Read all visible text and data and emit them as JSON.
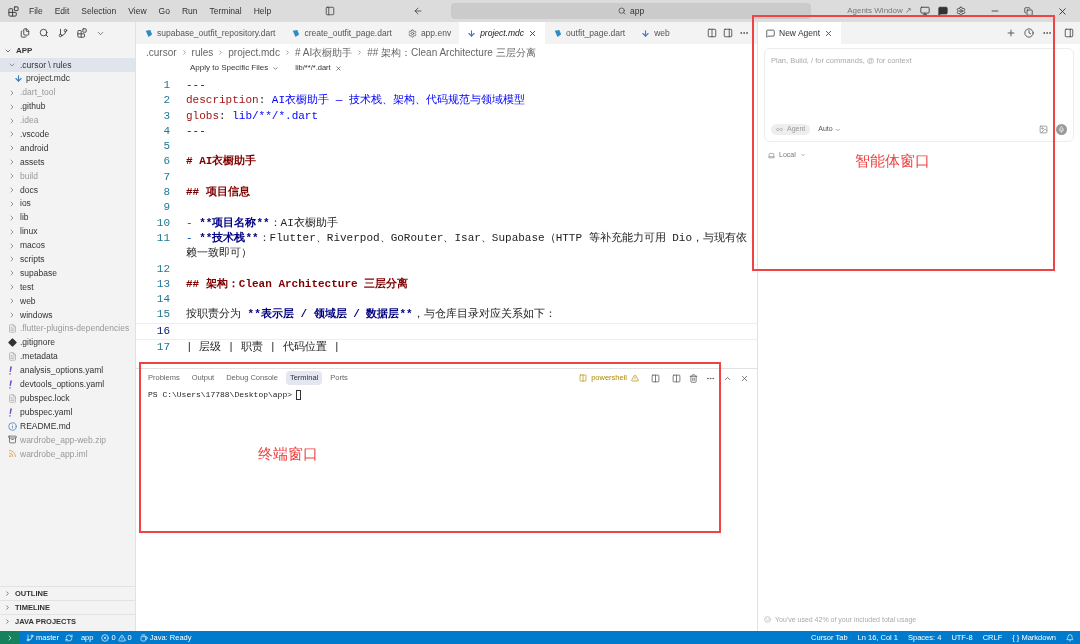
{
  "menu": [
    "File",
    "Edit",
    "Selection",
    "View",
    "Go",
    "Run",
    "Terminal",
    "Help"
  ],
  "search": {
    "value": "app"
  },
  "agents_window": "Agents Window ↗",
  "tabs": [
    {
      "label": "supabase_outfit_repository.dart",
      "kind": "dart",
      "selected": false
    },
    {
      "label": "create_outfit_page.dart",
      "kind": "dart",
      "selected": false
    },
    {
      "label": "app.env",
      "kind": "env",
      "selected": false
    },
    {
      "label": "project.mdc",
      "kind": "mdc",
      "selected": true
    },
    {
      "label": "outfit_page.dart",
      "kind": "dart",
      "selected": false
    },
    {
      "label": "web",
      "kind": "mdc",
      "selected": false
    }
  ],
  "breadcrumbs": [
    ".cursor",
    "rules",
    "project.mdc",
    "# AI衣橱助手",
    "## 架构：Clean Architecture 三层分离"
  ],
  "rule_bar": {
    "mode": "Apply to Specific Files",
    "glob": "lib/**/*.dart"
  },
  "explorer": {
    "title": "APP",
    "items": [
      {
        "label": ".cursor \\ rules",
        "kind": "folder",
        "dimmed": false,
        "selected": true,
        "expanded": true,
        "children": [
          {
            "label": "project.mdc",
            "kind": "mdc",
            "dimmed": false,
            "selected": false
          }
        ]
      },
      {
        "label": ".dart_tool",
        "kind": "folder",
        "dimmed": true,
        "selected": false,
        "expanded": false
      },
      {
        "label": ".github",
        "kind": "folder",
        "dimmed": false,
        "selected": false,
        "expanded": false
      },
      {
        "label": ".idea",
        "kind": "folder",
        "dimmed": true,
        "selected": false,
        "expanded": false
      },
      {
        "label": ".vscode",
        "kind": "folder",
        "dimmed": false,
        "selected": false,
        "expanded": false
      },
      {
        "label": "android",
        "kind": "folder",
        "dimmed": false,
        "selected": false,
        "expanded": false
      },
      {
        "label": "assets",
        "kind": "folder",
        "dimmed": false,
        "selected": false,
        "expanded": false
      },
      {
        "label": "build",
        "kind": "folder",
        "dimmed": true,
        "selected": false,
        "expanded": false
      },
      {
        "label": "docs",
        "kind": "folder",
        "dimmed": false,
        "selected": false,
        "expanded": false
      },
      {
        "label": "ios",
        "kind": "folder",
        "dimmed": false,
        "selected": false,
        "expanded": false
      },
      {
        "label": "lib",
        "kind": "folder",
        "dimmed": false,
        "selected": false,
        "expanded": false
      },
      {
        "label": "linux",
        "kind": "folder",
        "dimmed": false,
        "selected": false,
        "expanded": false
      },
      {
        "label": "macos",
        "kind": "folder",
        "dimmed": false,
        "selected": false,
        "expanded": false
      },
      {
        "label": "scripts",
        "kind": "folder",
        "dimmed": false,
        "selected": false,
        "expanded": false
      },
      {
        "label": "supabase",
        "kind": "folder",
        "dimmed": false,
        "selected": false,
        "expanded": false
      },
      {
        "label": "test",
        "kind": "folder",
        "dimmed": false,
        "selected": false,
        "expanded": false
      },
      {
        "label": "web",
        "kind": "folder",
        "dimmed": false,
        "selected": false,
        "expanded": false
      },
      {
        "label": "windows",
        "kind": "folder",
        "dimmed": false,
        "selected": false,
        "expanded": false
      },
      {
        "label": ".flutter-plugins-dependencies",
        "kind": "text",
        "dimmed": true,
        "selected": false
      },
      {
        "label": ".gitignore",
        "kind": "git",
        "dimmed": false,
        "selected": false
      },
      {
        "label": ".metadata",
        "kind": "text",
        "dimmed": false,
        "selected": false
      },
      {
        "label": "analysis_options.yaml",
        "kind": "yaml",
        "dimmed": false,
        "selected": false
      },
      {
        "label": "devtools_options.yaml",
        "kind": "yaml",
        "dimmed": false,
        "selected": false
      },
      {
        "label": "pubspec.lock",
        "kind": "text",
        "dimmed": false,
        "selected": false
      },
      {
        "label": "pubspec.yaml",
        "kind": "yaml",
        "dimmed": false,
        "selected": false
      },
      {
        "label": "README.md",
        "kind": "info",
        "dimmed": false,
        "selected": false
      },
      {
        "label": "wardrobe_app-web.zip",
        "kind": "zip",
        "dimmed": true,
        "selected": false
      },
      {
        "label": "wardrobe_app.iml",
        "kind": "rss",
        "dimmed": true,
        "selected": false
      }
    ]
  },
  "sections": [
    "OUTLINE",
    "TIMELINE",
    "JAVA PROJECTS"
  ],
  "editor": {
    "lines": [
      {
        "number": "1",
        "current": false,
        "segments": [
          {
            "kind": "plain",
            "text": "---"
          }
        ]
      },
      {
        "number": "2",
        "current": false,
        "segments": [
          {
            "kind": "key",
            "text": "description"
          },
          {
            "kind": "plain",
            "text": ": "
          },
          {
            "kind": "value",
            "text": "AI衣橱助手 — 技术栈、架构、代码规范与领域模型"
          }
        ]
      },
      {
        "number": "3",
        "current": false,
        "segments": [
          {
            "kind": "key",
            "text": "globs"
          },
          {
            "kind": "plain",
            "text": ": "
          },
          {
            "kind": "value",
            "text": "lib/**/*.dart"
          }
        ]
      },
      {
        "number": "4",
        "current": false,
        "segments": [
          {
            "kind": "plain",
            "text": "---"
          }
        ]
      },
      {
        "number": "5",
        "current": false
      },
      {
        "number": "6",
        "current": false,
        "segments": [
          {
            "kind": "heading",
            "text": "# AI衣橱助手"
          }
        ]
      },
      {
        "number": "7",
        "current": false
      },
      {
        "number": "8",
        "current": false,
        "segments": [
          {
            "kind": "heading",
            "text": "## 项目信息"
          }
        ]
      },
      {
        "number": "9",
        "current": false
      },
      {
        "number": "10",
        "current": false,
        "segments": [
          {
            "kind": "punct",
            "text": "- "
          },
          {
            "kind": "bold",
            "text": "**项目名称**"
          },
          {
            "kind": "plain",
            "text": "：AI衣橱助手"
          }
        ]
      },
      {
        "number": "11",
        "current": false,
        "segments": [
          {
            "kind": "punct",
            "text": "- "
          },
          {
            "kind": "bold",
            "text": "**技术栈**"
          },
          {
            "kind": "plain",
            "text": "：Flutter、Riverpod、GoRouter、Isar、Supabase（HTTP 等补充能力可用 Dio，与现有依赖一致即可）"
          }
        ]
      },
      {
        "number": "12",
        "current": false
      },
      {
        "number": "13",
        "current": false,
        "segments": [
          {
            "kind": "heading",
            "text": "## 架构：Clean Architecture 三层分离"
          }
        ]
      },
      {
        "number": "14",
        "current": false
      },
      {
        "number": "15",
        "current": false,
        "segments": [
          {
            "kind": "plain",
            "text": "按职责分为 "
          },
          {
            "kind": "bold",
            "text": "**表示层 / 领域层 / 数据层**"
          },
          {
            "kind": "plain",
            "text": "，与仓库目录对应关系如下："
          }
        ]
      },
      {
        "number": "16",
        "current": true
      },
      {
        "number": "17",
        "current": false,
        "segments": [
          {
            "kind": "plain",
            "text": "| 层级 | 职责 | 代码位置 |"
          }
        ]
      }
    ]
  },
  "panel": {
    "tabs": [
      {
        "label": "Problems",
        "selected": false
      },
      {
        "label": "Output",
        "selected": false
      },
      {
        "label": "Debug Console",
        "selected": false
      },
      {
        "label": "Terminal",
        "selected": true
      },
      {
        "label": "Ports",
        "selected": false
      }
    ],
    "shell": "powershell",
    "prompt": "PS C:\\Users\\17788\\Desktop\\app>"
  },
  "agent": {
    "tab": "New Agent",
    "placeholder": "Plan, Build, / for commands, @ for context",
    "mode": "Agent",
    "model": "Auto",
    "location": "Local",
    "usage": "You've used 42% of your included total usage"
  },
  "status_bar": {
    "left": [
      {
        "kind": "branch",
        "text": "master"
      },
      {
        "kind": "sync",
        "text": "app"
      },
      {
        "kind": "problems",
        "text": "0",
        "warnings": "0"
      },
      {
        "kind": "java",
        "text": "Java: Ready"
      }
    ],
    "right": [
      "Cursor Tab",
      "Ln 16, Col 1",
      "Spaces: 4",
      "UTF-8",
      "CRLF",
      "{ } Markdown"
    ]
  },
  "annotations": [
    {
      "kind": "agent",
      "text": "智能体窗口"
    },
    {
      "kind": "terminal",
      "text": "终端窗口"
    }
  ]
}
